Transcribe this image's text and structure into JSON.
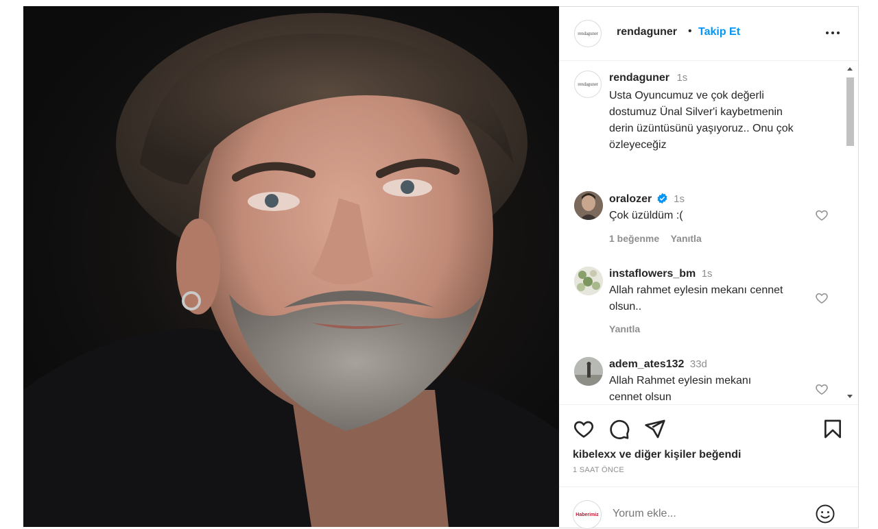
{
  "post": {
    "author": "rendaguner",
    "author_logo_text": "rendaguner",
    "separator": "•",
    "follow_label": "Takip Et"
  },
  "caption": {
    "user": "rendaguner",
    "time": "1s",
    "text_lines": [
      "Usta Oyuncumuz ve çok değerli",
      "dostumuz Ünal Silver'i kaybetmenin",
      "derin üzüntüsünü yaşıyoruz.. Onu çok",
      "özleyeceğiz"
    ]
  },
  "comments": [
    {
      "user": "oralozer",
      "verified": true,
      "time": "1s",
      "text_lines": [
        "Çok üzüldüm :("
      ],
      "likes": "1 beğenme",
      "reply": "Yanıtla"
    },
    {
      "user": "instaflowers_bm",
      "verified": false,
      "time": "1s",
      "text_lines": [
        "Allah rahmet eylesin mekanı cennet",
        "olsun.."
      ],
      "likes": "",
      "reply": "Yanıtla"
    },
    {
      "user": "adem_ates132",
      "verified": false,
      "time": "33d",
      "text_lines": [
        "Allah Rahmet eylesin mekanı",
        "cennet olsun"
      ],
      "likes": "",
      "reply": ""
    }
  ],
  "actions": {
    "liked_by": "kibelexx ve diğer kişiler beğendi",
    "timestamp": "1 SAAT ÖNCE"
  },
  "add_comment": {
    "placeholder": "Yorum ekle...",
    "avatar_text": "Haberimiz"
  },
  "icons": {
    "like": "heart-icon",
    "comment": "comment-icon",
    "share": "share-icon",
    "save": "bookmark-icon",
    "more": "more-icon",
    "emoji": "emoji-icon",
    "verified": "verified-badge-icon"
  },
  "colors": {
    "link": "#0095f6",
    "text": "#262626",
    "muted": "#8e8e8e",
    "verified": "#0095f6"
  }
}
